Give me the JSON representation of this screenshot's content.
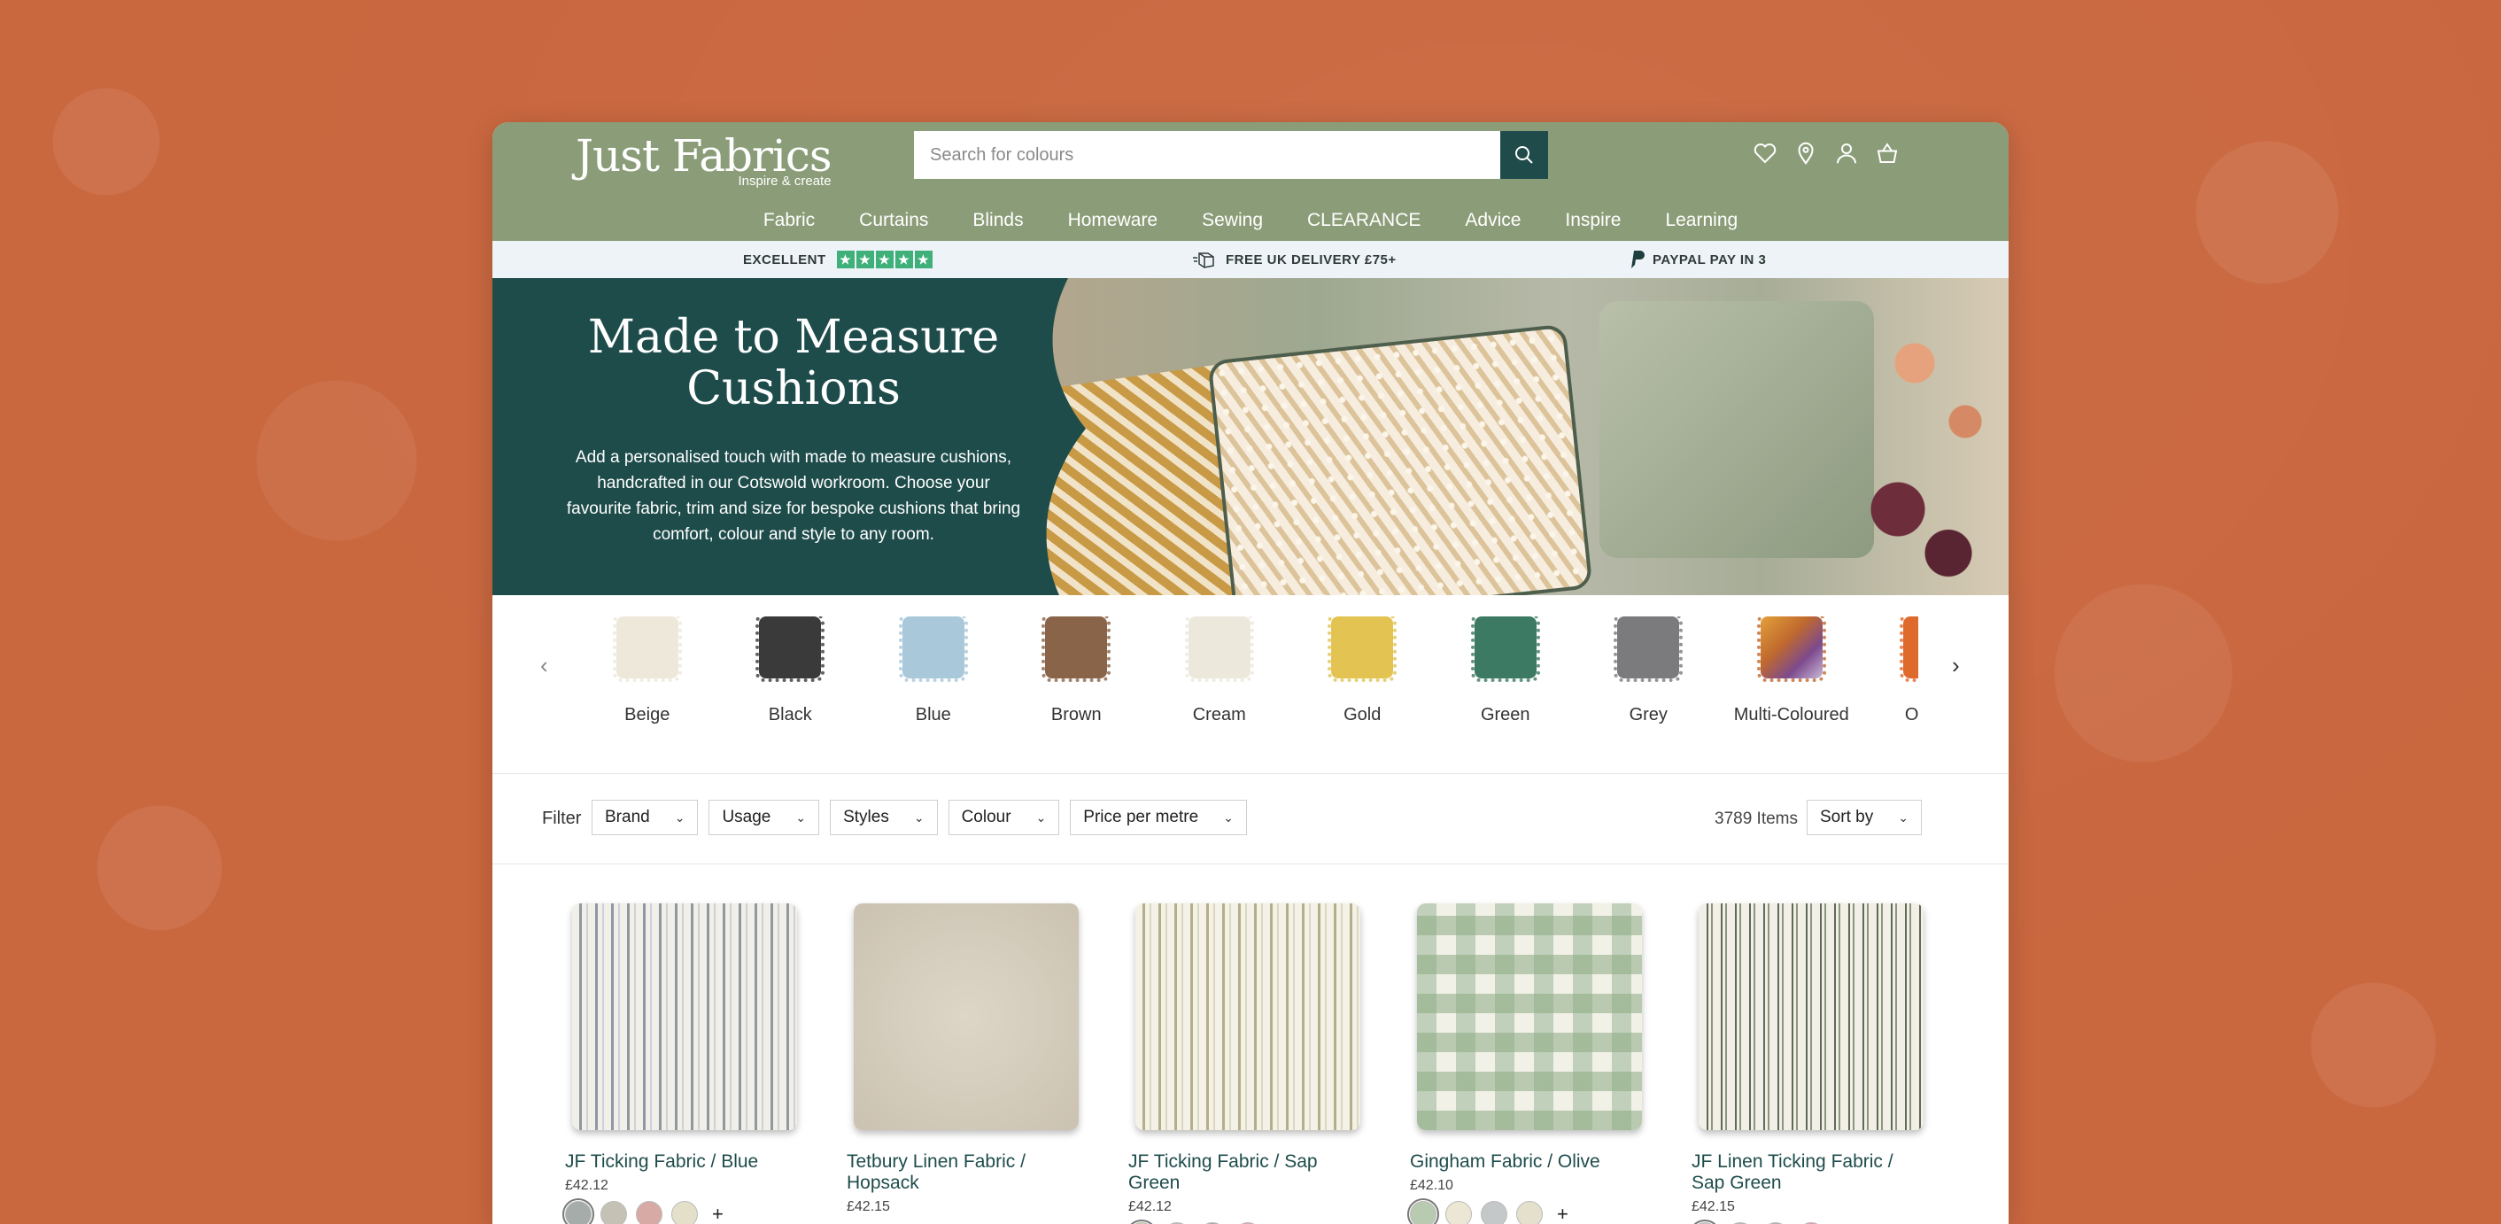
{
  "header": {
    "logo": "Just Fabrics",
    "tagline": "Inspire & create",
    "search_placeholder": "Search for colours",
    "nav": [
      "Fabric",
      "Curtains",
      "Blinds",
      "Homeware",
      "Sewing",
      "CLEARANCE",
      "Advice",
      "Inspire",
      "Learning"
    ]
  },
  "trustbar": {
    "rating": "EXCELLENT",
    "delivery": "FREE UK DELIVERY £75+",
    "paypal": "PAYPAL PAY IN 3"
  },
  "hero": {
    "title": "Made to Measure Cushions",
    "description": "Add a personalised touch with made to measure cushions, handcrafted in our Cotswold workroom. Choose your favourite fabric, trim and size for bespoke cushions that bring comfort, colour and style to any room."
  },
  "colours": [
    {
      "label": "Beige",
      "color": "#eee8da"
    },
    {
      "label": "Black",
      "color": "#3a3a3a"
    },
    {
      "label": "Blue",
      "color": "#a9c8d9"
    },
    {
      "label": "Brown",
      "color": "#8a6448"
    },
    {
      "label": "Cream",
      "color": "#ece8dc"
    },
    {
      "label": "Gold",
      "color": "#e3c453"
    },
    {
      "label": "Green",
      "color": "#3d7a63"
    },
    {
      "label": "Grey",
      "color": "#7b7b7d"
    },
    {
      "label": "Multi-Coloured",
      "color": "#c0692e"
    },
    {
      "label": "Orange",
      "color": "#df6a2e"
    }
  ],
  "filters": {
    "label": "Filter",
    "buttons": [
      "Brand",
      "Usage",
      "Styles",
      "Colour",
      "Price per metre"
    ],
    "items_count": "3789 Items",
    "sort_label": "Sort by"
  },
  "products": [
    {
      "title": "JF Ticking Fabric / Blue",
      "price": "£42.12",
      "swatches": [
        "#a6aca9",
        "#c5c2b5",
        "#d7aaa6",
        "#e4dfc8"
      ]
    },
    {
      "title": "Tetbury Linen Fabric / Hopsack",
      "price": "£42.15",
      "swatches": []
    },
    {
      "title": "JF Ticking Fabric / Sap Green",
      "price": "£42.12",
      "swatches": [
        "#d6d0a8",
        "#bab9b2",
        "#a9aaa8",
        "#d7aaa6"
      ]
    },
    {
      "title": "Gingham Fabric / Olive",
      "price": "£42.10",
      "swatches": [
        "#b8cbb0",
        "#ece6d4",
        "#c4c8c9",
        "#e4e0cc"
      ]
    },
    {
      "title": "JF Linen Ticking Fabric / Sap Green",
      "price": "£42.15",
      "swatches": [
        "#c9c8c0",
        "#b5b5b3",
        "#b0b2ad",
        "#e49aa4"
      ]
    }
  ],
  "product_colors": {
    "p1": "#b8bcc2",
    "p2": "#d8d0bf",
    "p3": "#d4d0b6",
    "p4": "#b5c8ad",
    "p5": "#cfcfbf"
  }
}
